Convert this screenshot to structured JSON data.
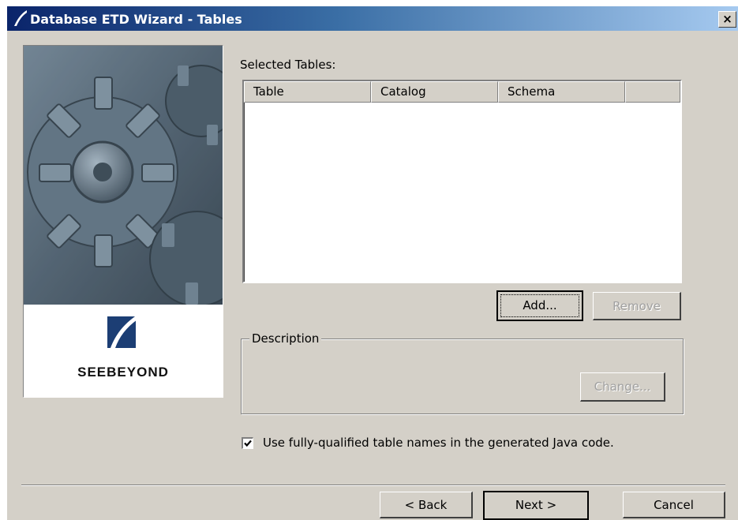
{
  "window": {
    "title": "Database ETD Wizard - Tables",
    "close_label": "×"
  },
  "side_panel": {
    "brand_text": "SEEBEYOND"
  },
  "selected_tables": {
    "label": "Selected Tables:",
    "columns": [
      "Table",
      "Catalog",
      "Schema",
      ""
    ],
    "rows": []
  },
  "buttons": {
    "add": "Add...",
    "remove": "Remove",
    "change": "Change...",
    "back": "< Back",
    "next": "Next >",
    "cancel": "Cancel"
  },
  "description": {
    "legend": "Description",
    "text": ""
  },
  "options": {
    "fully_qualified_label": "Use fully-qualified table names in the generated Java code.",
    "fully_qualified_checked": true
  }
}
